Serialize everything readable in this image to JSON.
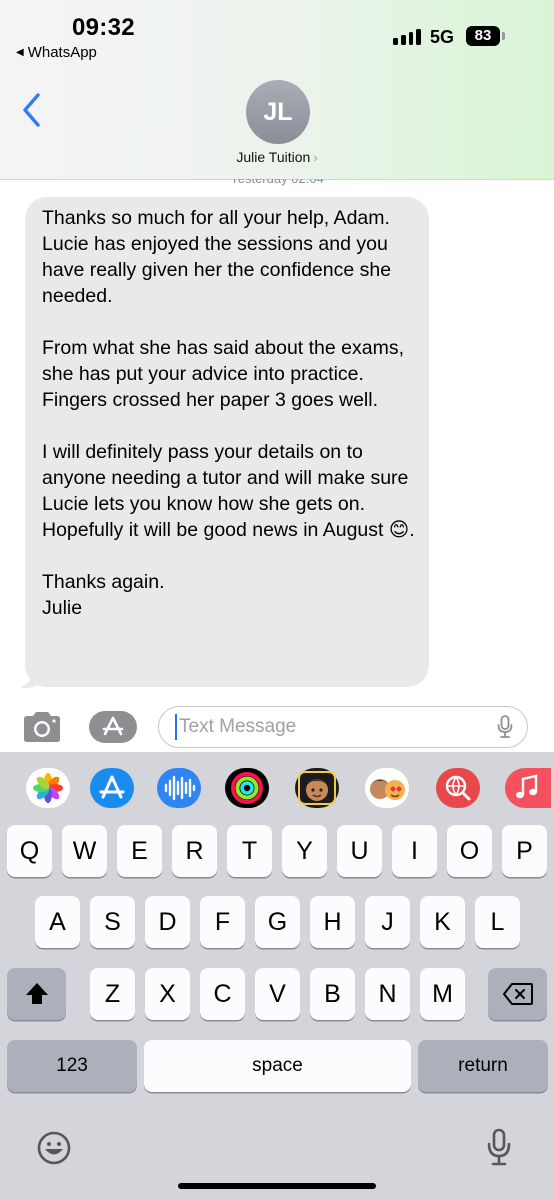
{
  "status_bar": {
    "time": "09:32",
    "back_app": "WhatsApp",
    "network": "5G",
    "battery": "83"
  },
  "header": {
    "avatar_initials": "JL",
    "contact_name": "Julie Tuition",
    "name_chevron": "›"
  },
  "conversation": {
    "timestamp": "Yesterday 02:04",
    "messages": [
      {
        "direction": "incoming",
        "paragraphs": [
          "Thanks so much for all your help, Adam. Lucie has enjoyed the sessions and you have really given her the confidence she needed.",
          "From what she has said about the exams, she has put your advice into practice. Fingers crossed her paper 3 goes well.",
          "I will definitely pass your details on to anyone needing a tutor and will make sure Lucie lets you know how she gets on. Hopefully it will be good news in August 😊.",
          "Thanks again.\nJulie"
        ]
      }
    ]
  },
  "composer": {
    "placeholder": "Text Message",
    "icons": [
      "camera-icon",
      "app-store-icon",
      "microphone-icon"
    ]
  },
  "app_strip": [
    {
      "name": "photos",
      "color": "#ffffff"
    },
    {
      "name": "app-store",
      "color": "#1a8cf0"
    },
    {
      "name": "audio-message",
      "color": "#2f86f2"
    },
    {
      "name": "fitness-activity",
      "color": "#000000"
    },
    {
      "name": "memoji",
      "color": "#1b1b1b"
    },
    {
      "name": "memoji-stickers",
      "color": "#ffffff"
    },
    {
      "name": "web-images",
      "color": "#e8484a"
    },
    {
      "name": "music",
      "color": "#f5505e"
    }
  ],
  "keyboard": {
    "row1": [
      "Q",
      "W",
      "E",
      "R",
      "T",
      "Y",
      "U",
      "I",
      "O",
      "P"
    ],
    "row2": [
      "A",
      "S",
      "D",
      "F",
      "G",
      "H",
      "J",
      "K",
      "L"
    ],
    "row3": [
      "Z",
      "X",
      "C",
      "V",
      "B",
      "N",
      "M"
    ],
    "numbers_label": "123",
    "space_label": "space",
    "return_label": "return",
    "icons": [
      "shift-icon",
      "backspace-icon",
      "emoji-icon",
      "dictation-icon"
    ]
  }
}
